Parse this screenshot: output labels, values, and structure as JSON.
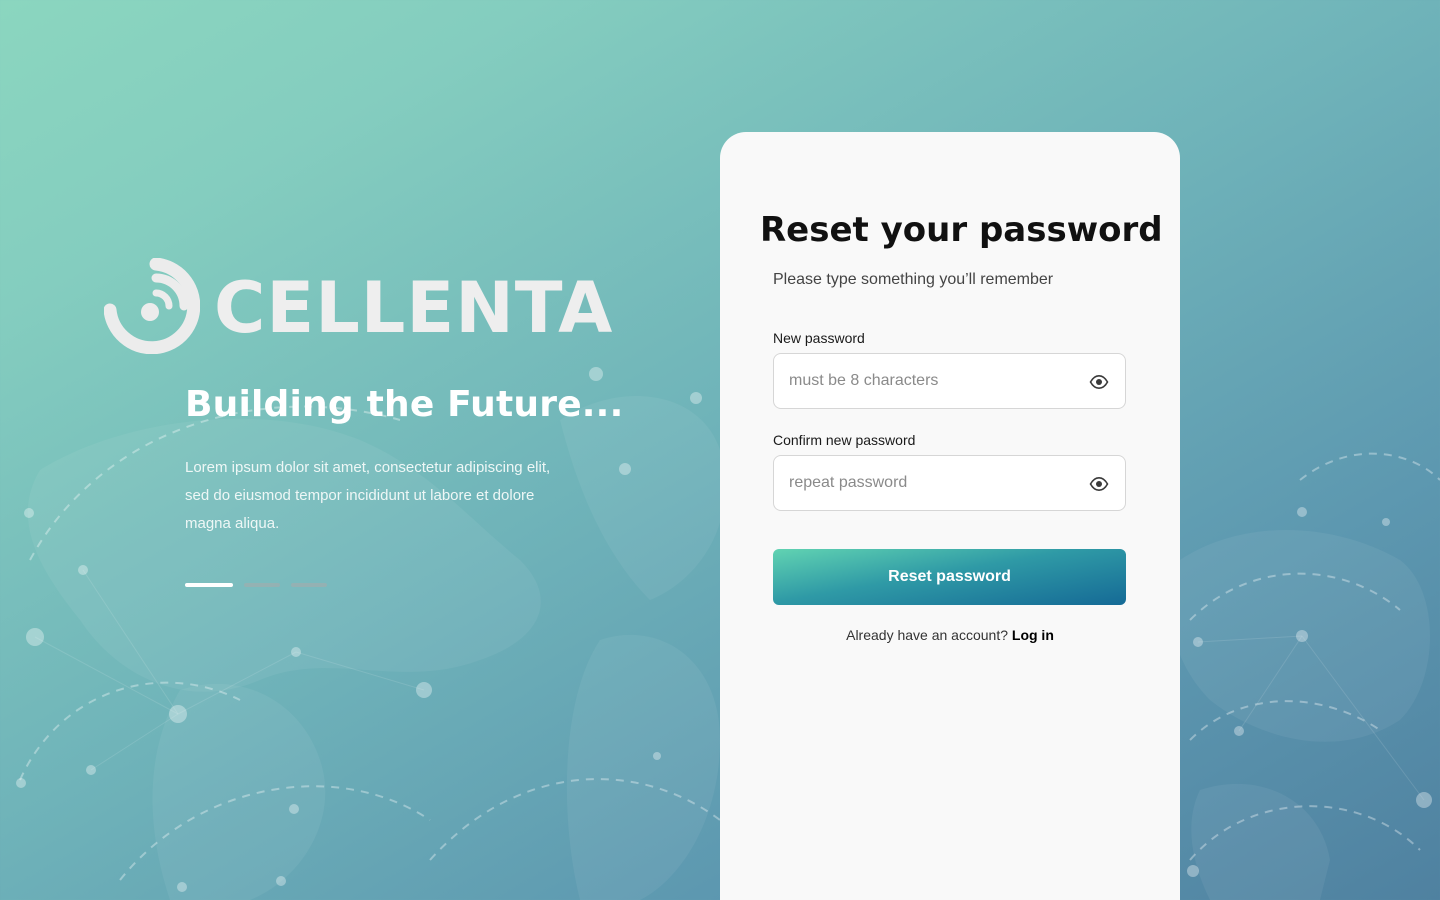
{
  "brand": {
    "logo_text": "CELLENTA",
    "logo_icon": "cellenta-signal-logo-icon"
  },
  "hero": {
    "title": "Building the Future...",
    "description": "Lorem ipsum dolor sit amet, consectetur adipiscing elit, sed do eiusmod tempor incididunt ut labore et dolore magna aliqua.",
    "slides": {
      "count": 3,
      "active_index": 0
    }
  },
  "form": {
    "title": "Reset your password",
    "subtitle": "Please type something you’ll remember",
    "new_password": {
      "label": "New password",
      "value": "",
      "placeholder": "must be 8 characters",
      "toggle_icon": "eye-icon"
    },
    "confirm_password": {
      "label": "Confirm new password",
      "value": "",
      "placeholder": "repeat password",
      "toggle_icon": "eye-icon"
    },
    "submit_label": "Reset password",
    "footer_text": "Already have an account?",
    "login_link": "Log in"
  },
  "colors": {
    "background_start": "#8bd6bf",
    "background_end": "#4f81a0",
    "card": "#f9f9f9",
    "button_start": "#61d3b2",
    "button_end": "#156a96"
  }
}
